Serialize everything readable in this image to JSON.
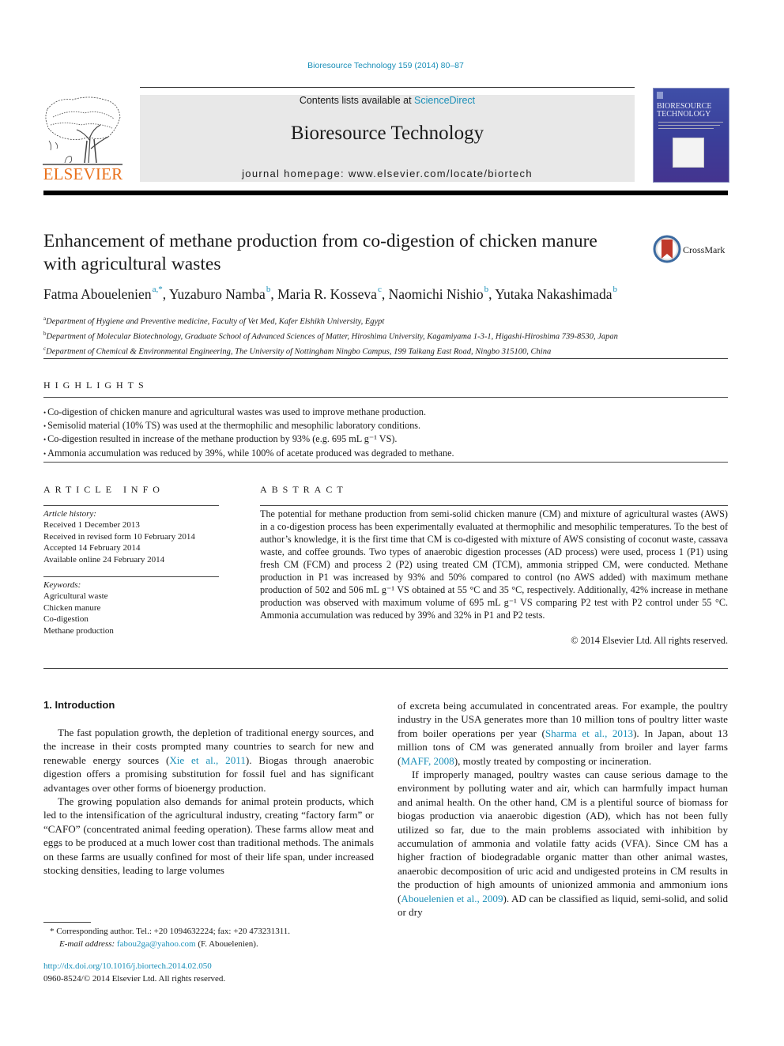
{
  "header": {
    "citation": "Bioresource Technology 159 (2014) 80–87",
    "contents_prefix": "Contents lists available at ",
    "contents_link": "ScienceDirect",
    "journal_name": "Bioresource Technology",
    "homepage_prefix": "journal homepage: ",
    "homepage_url": "www.elsevier.com/locate/biortech",
    "publisher": "ELSEVIER",
    "cover_title_line1": "BIORESOURCE",
    "cover_title_line2": "TECHNOLOGY",
    "crossmark_label": "CrossMark"
  },
  "article": {
    "title": "Enhancement of methane production from co-digestion of chicken manure with agricultural wastes",
    "authors": [
      {
        "name": "Fatma Abouelenien",
        "sup": "a,*"
      },
      {
        "name": "Yuzaburo Namba",
        "sup": "b"
      },
      {
        "name": "Maria R. Kosseva",
        "sup": "c"
      },
      {
        "name": "Naomichi Nishio",
        "sup": "b"
      },
      {
        "name": "Yutaka Nakashimada",
        "sup": "b"
      }
    ],
    "affiliations": [
      {
        "sup": "a",
        "text": "Department of Hygiene and Preventive medicine, Faculty of Vet Med, Kafer Elshikh University, Egypt"
      },
      {
        "sup": "b",
        "text": "Department of Molecular Biotechnology, Graduate School of Advanced Sciences of Matter, Hiroshima University, Kagamiyama 1-3-1, Higashi-Hiroshima 739-8530, Japan"
      },
      {
        "sup": "c",
        "text": "Department of Chemical & Environmental Engineering, The University of Nottingham Ningbo Campus, 199 Taikang East Road, Ningbo 315100, China"
      }
    ]
  },
  "highlights": {
    "heading": "HIGHLIGHTS",
    "items": [
      "Co-digestion of chicken manure and agricultural wastes was used to improve methane production.",
      "Semisolid material (10% TS) was used at the thermophilic and mesophilic laboratory conditions.",
      "Co-digestion resulted in increase of the methane production by 93% (e.g. 695 mL g⁻¹ VS).",
      "Ammonia accumulation was reduced by 39%, while 100% of acetate produced was degraded to methane."
    ]
  },
  "article_info": {
    "heading": "ARTICLE INFO",
    "history_label": "Article history:",
    "history": [
      "Received 1 December 2013",
      "Received in revised form 10 February 2014",
      "Accepted 14 February 2014",
      "Available online 24 February 2014"
    ],
    "keywords_label": "Keywords:",
    "keywords": [
      "Agricultural waste",
      "Chicken manure",
      "Co-digestion",
      "Methane production"
    ]
  },
  "abstract": {
    "heading": "ABSTRACT",
    "text": "The potential for methane production from semi-solid chicken manure (CM) and mixture of agricultural wastes (AWS) in a co-digestion process has been experimentally evaluated at thermophilic and mesophilic temperatures. To the best of author’s knowledge, it is the first time that CM is co-digested with mixture of AWS consisting of coconut waste, cassava waste, and coffee grounds. Two types of anaerobic digestion processes (AD process) were used, process 1 (P1) using fresh CM (FCM) and process 2 (P2) using treated CM (TCM), ammonia stripped CM, were conducted. Methane production in P1 was increased by 93% and 50% compared to control (no AWS added) with maximum methane production of 502 and 506 mL g⁻¹ VS obtained at 55 °C and 35 °C, respectively. Additionally, 42% increase in methane production was observed with maximum volume of 695 mL g⁻¹ VS comparing P2 test with P2 control under 55 °C. Ammonia accumulation was reduced by 39% and 32% in P1 and P2 tests.",
    "copyright": "© 2014 Elsevier Ltd. All rights reserved."
  },
  "body": {
    "intro_heading": "1. Introduction",
    "p1_a": "The fast population growth, the depletion of traditional energy sources, and the increase in their costs prompted many countries to search for new and renewable energy sources (",
    "p1_cite": "Xie et al., 2011",
    "p1_b": "). Biogas through anaerobic digestion offers a promising substitution for fossil fuel and has significant advantages over other forms of bioenergy production.",
    "p2": "The growing population also demands for animal protein products, which led to the intensification of the agricultural industry, creating “factory farm” or “CAFO” (concentrated animal feeding operation). These farms allow meat and eggs to be produced at a much lower cost than traditional methods. The animals on these farms are usually confined for most of their life span, under increased stocking densities, leading to large volumes",
    "r1_a": "of excreta being accumulated in concentrated areas. For example, the poultry industry in the USA generates more than 10 million tons of poultry litter waste from boiler operations per year (",
    "r1_cite1": "Sharma et al., 2013",
    "r1_b": "). In Japan, about 13 million tons of CM was generated annually from broiler and layer farms (",
    "r1_cite2": "MAFF, 2008",
    "r1_c": "), mostly treated by composting or incineration.",
    "r2_a": "If improperly managed, poultry wastes can cause serious damage to the environment by polluting water and air, which can harmfully impact human and animal health. On the other hand, CM is a plentiful source of biomass for biogas production via anaerobic digestion (AD), which has not been fully utilized so far, due to the main problems associated with inhibition by accumulation of ammonia and volatile fatty acids (VFA). Since CM has a higher fraction of biodegradable organic matter than other animal wastes, anaerobic decomposition of uric acid and undigested proteins in CM results in the production of high amounts of unionized ammonia and ammonium ions (",
    "r2_cite": "Abouelenien et al., 2009",
    "r2_b": "). AD can be classified as liquid, semi-solid, and solid or dry"
  },
  "footnote": {
    "star": "*",
    "corresponding": "Corresponding author. Tel.: +20 1094632224; fax: +20 473231311.",
    "email_label": "E-mail address: ",
    "email": "fabou2ga@yahoo.com",
    "email_suffix": " (F. Abouelenien).",
    "doi": "http://dx.doi.org/10.1016/j.biortech.2014.02.050",
    "issn": "0960-8524/© 2014 Elsevier Ltd. All rights reserved."
  },
  "colors": {
    "link": "#1a8fb8",
    "elsevier_orange": "#e9711c",
    "banner_gray": "#e8e8e8",
    "cover_blue": "#3f4fa8"
  }
}
